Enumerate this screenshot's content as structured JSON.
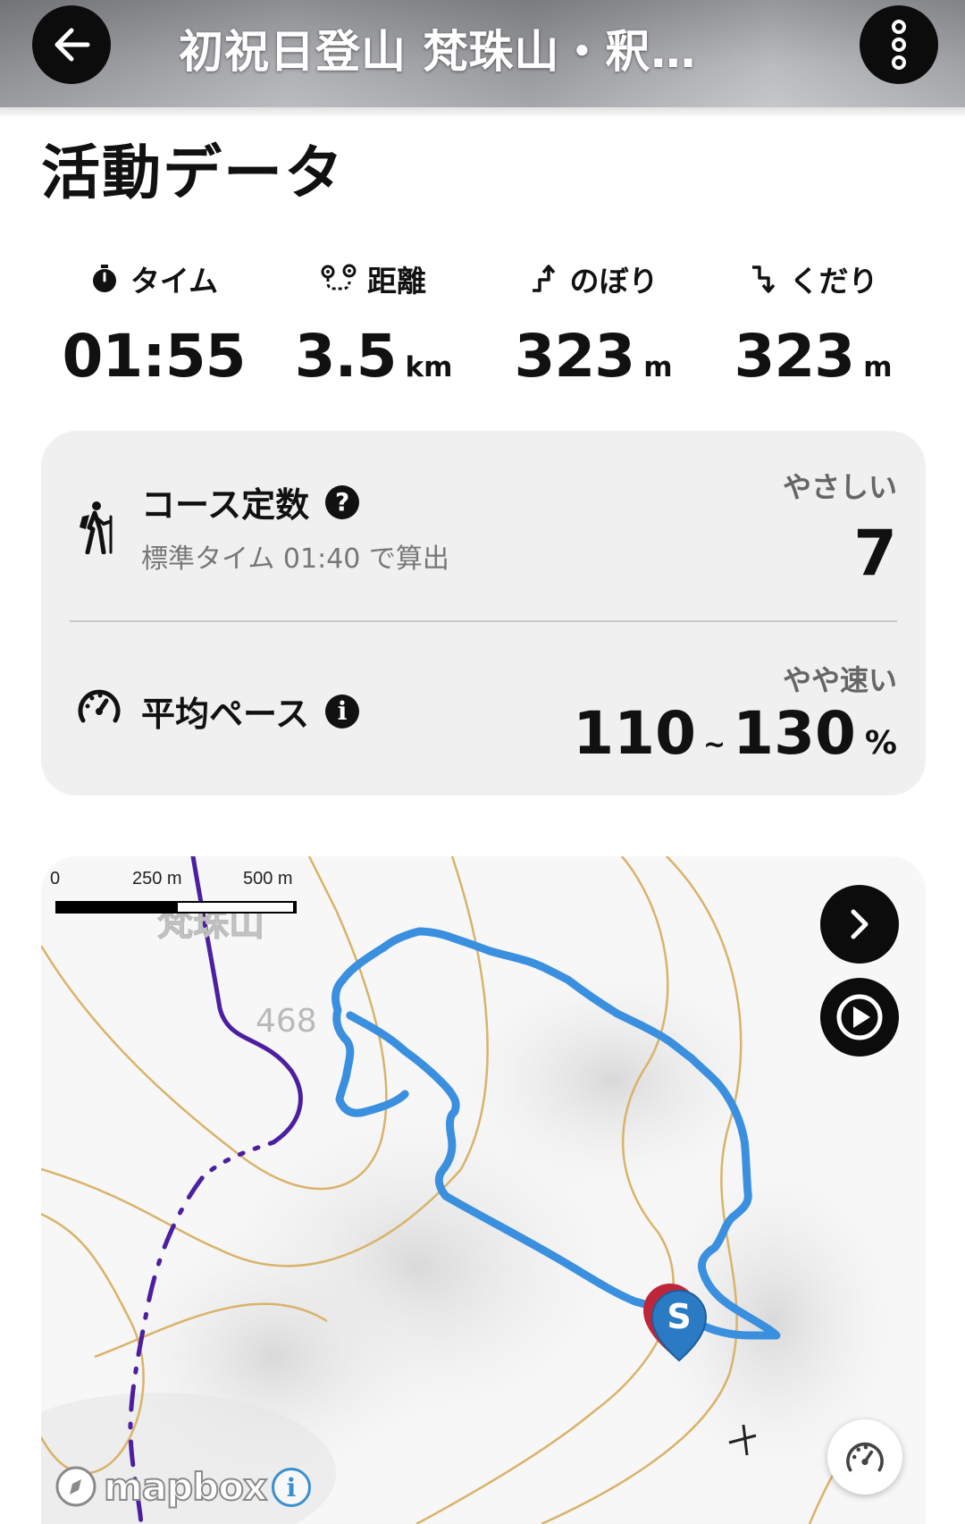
{
  "header": {
    "title": "初祝日登山 梵珠山・釈…"
  },
  "section": {
    "title": "活動データ"
  },
  "stats": [
    {
      "label": "タイム",
      "value": "01:55",
      "unit": "",
      "icon": "stopwatch-icon"
    },
    {
      "label": "距離",
      "value": "3.5",
      "unit": "km",
      "icon": "route-icon"
    },
    {
      "label": "のぼり",
      "value": "323",
      "unit": "m",
      "icon": "ascent-icon"
    },
    {
      "label": "くだり",
      "value": "323",
      "unit": "m",
      "icon": "descent-icon"
    }
  ],
  "course": {
    "title": "コース定数",
    "subtitle": "標準タイム 01:40 で算出",
    "caption": "やさしい",
    "value": "7"
  },
  "pace": {
    "title": "平均ペース",
    "caption": "やや速い",
    "value_min": "110",
    "separator": "~",
    "value_max": "130",
    "unit": "%"
  },
  "map": {
    "scale_labels": [
      "0",
      "250 m",
      "500 m"
    ],
    "place_label": "梵珠山",
    "elevation_label": "468",
    "start_marker": "S",
    "attribution": "mapbox",
    "info": "i"
  },
  "colors": {
    "track": "#3a8fdf",
    "trail": "#4b1fa0",
    "contour": "#d9b36a",
    "marker_blue": "#2b7ac4",
    "marker_red": "#c0263a"
  }
}
